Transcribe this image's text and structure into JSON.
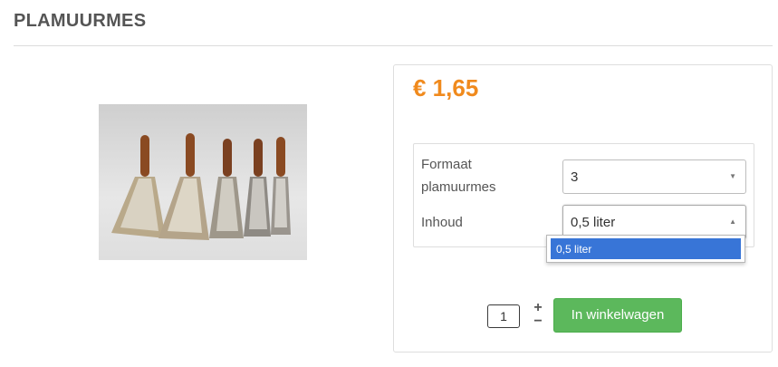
{
  "page": {
    "title": "PLAMUURMES"
  },
  "product": {
    "price": "€ 1,65",
    "image_alt": "plamuurmessen"
  },
  "options": {
    "formaat": {
      "label": "Formaat plamuurmes",
      "value": "3"
    },
    "inhoud": {
      "label": "Inhoud",
      "value": "0,5 liter",
      "dropdown_options": [
        "0,5 liter"
      ]
    }
  },
  "cart": {
    "quantity": "1",
    "plus": "+",
    "minus": "−",
    "button_label": "In winkelwagen"
  },
  "colors": {
    "price": "#f08a1d",
    "cart_button": "#5cb85c",
    "dropdown_highlight": "#3875d7"
  }
}
